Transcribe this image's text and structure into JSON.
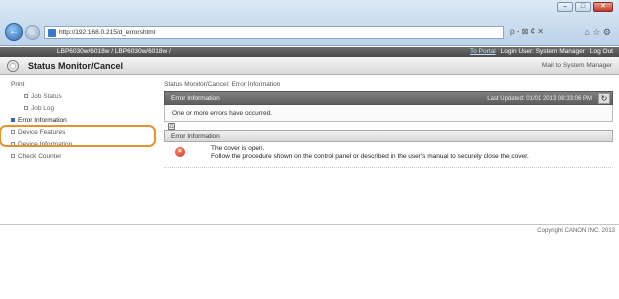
{
  "browser": {
    "url": "http://192.168.0.215/d_errorshtml",
    "address_tools": "ρ - ⊠ ¢ ✕",
    "right_icons": "⌂ ☆ ⚙",
    "window_controls": {
      "minimize": "–",
      "maximize": "□",
      "close": "✕"
    }
  },
  "header": {
    "model": "LBP6030w/6018w / LBP6030w/6018w /",
    "portal_link": "To Portal",
    "login_user": "Login User: System Manager",
    "logout": "Log Out",
    "page_title": "Status Monitor/Cancel",
    "mail_link": "Mail to System Manager"
  },
  "sidebar": {
    "items": [
      {
        "label": "Print",
        "level": "top",
        "bullet": false,
        "active": false
      },
      {
        "label": "Job Status",
        "level": "sub",
        "bullet": true,
        "active": false
      },
      {
        "label": "Job Log",
        "level": "sub",
        "bullet": true,
        "active": false
      },
      {
        "label": "Error Information",
        "level": "top",
        "bullet": true,
        "active": true
      },
      {
        "label": "Device Features",
        "level": "top",
        "bullet": true,
        "active": false
      },
      {
        "label": "Device Information",
        "level": "top",
        "bullet": true,
        "active": false
      },
      {
        "label": "Check Counter",
        "level": "top",
        "bullet": true,
        "active": false
      }
    ]
  },
  "main": {
    "breadcrumb": "Status Monitor/Cancel: Error Information",
    "panel_title": "Error Information",
    "last_updated": "Last Updated: 01/01 2013 08:33:06 PM",
    "summary": "One or more errors have occurred.",
    "section_title": "Error Information",
    "error_title": "The cover is open.",
    "error_detail": "Follow the procedure shown on the control panel or described in the user's manual to securely close the cover."
  },
  "footer": {
    "copyright": "Copyright CANON INC. 2013"
  }
}
